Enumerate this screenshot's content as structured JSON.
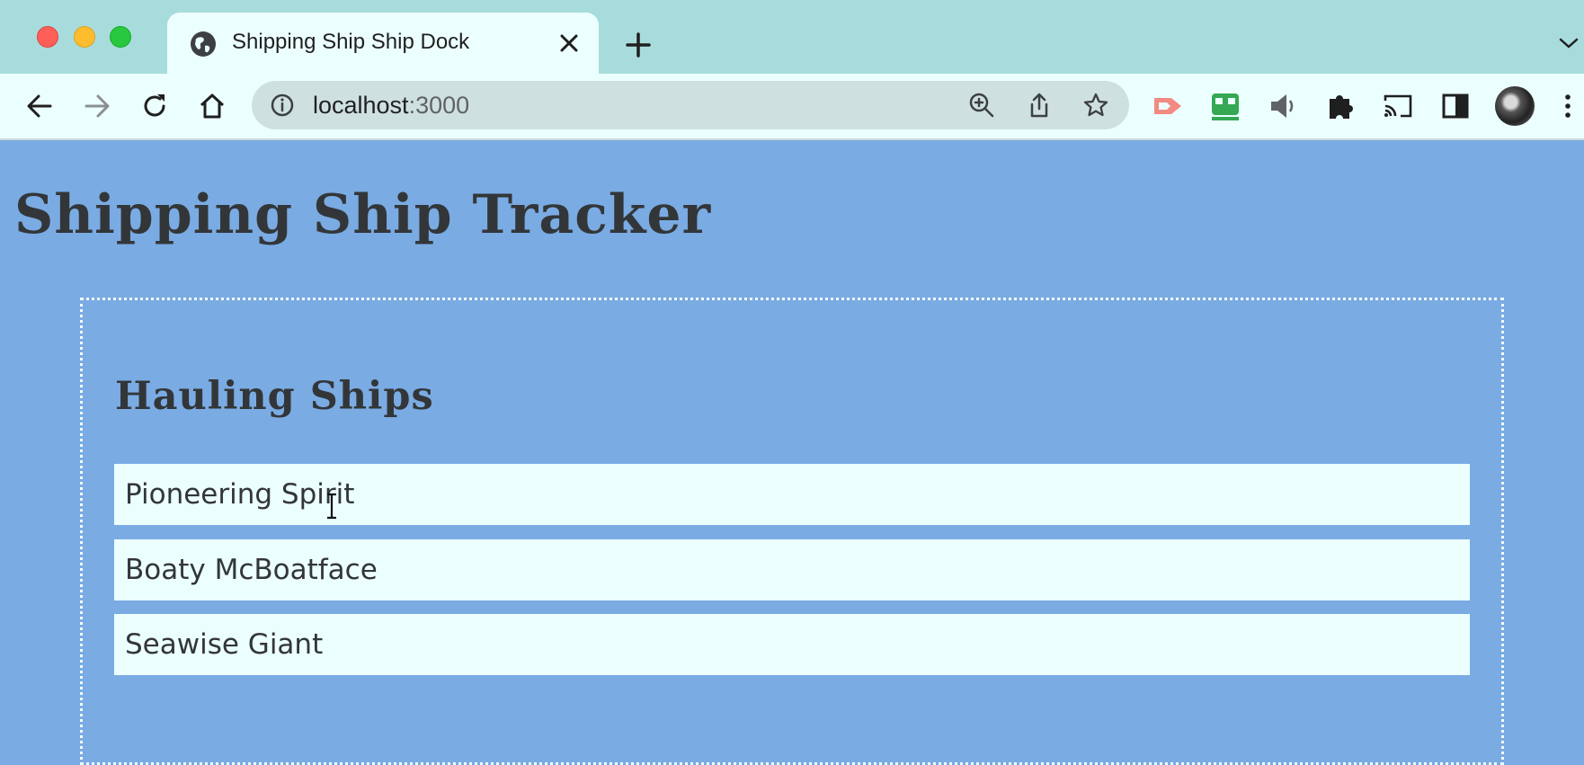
{
  "browser": {
    "tab": {
      "title": "Shipping Ship Ship Dock",
      "favicon": "globe-icon",
      "close_icon": "close-icon"
    },
    "new_tab_icon": "plus-icon",
    "tab_menu_icon": "chevron-down-icon",
    "nav": {
      "back_icon": "arrow-left-icon",
      "forward_icon": "arrow-right-icon",
      "reload_icon": "reload-icon",
      "home_icon": "home-icon"
    },
    "omnibox": {
      "host": "localhost",
      "port": ":3000",
      "info_icon": "info-icon",
      "zoom_icon": "zoom-in-icon",
      "share_icon": "share-icon",
      "bookmark_icon": "star-icon"
    },
    "extensions": [
      "tag-extension-icon",
      "robot-extension-icon",
      "speaker-icon",
      "puzzle-icon",
      "cast-icon",
      "side-panel-icon"
    ],
    "profile": "avatar",
    "menu_icon": "more-vertical-icon"
  },
  "page": {
    "title": "Shipping Ship Tracker",
    "dock": {
      "heading": "Hauling Ships",
      "ships": [
        {
          "name": "Pioneering Spirit"
        },
        {
          "name": "Boaty McBoatface"
        },
        {
          "name": "Seawise Giant"
        }
      ]
    }
  },
  "colors": {
    "page_background": "#7aabe3",
    "tabbar_background": "#a8dcdc",
    "chrome_background": "#ecffff",
    "text_dark": "#333638",
    "dock_border": "#f2ffff"
  }
}
